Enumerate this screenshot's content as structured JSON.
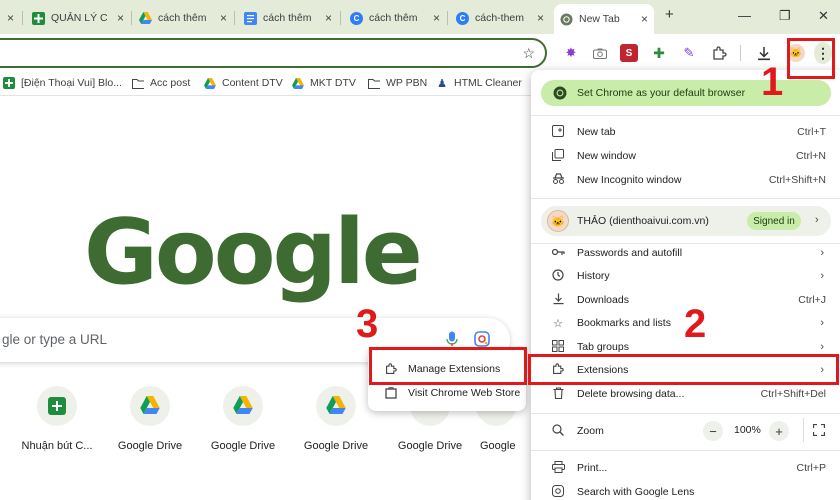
{
  "tabs": [
    {
      "label": "",
      "close": "×"
    },
    {
      "label": "QUẢN LÝ C",
      "close": "×"
    },
    {
      "label": "cách thêm",
      "close": "×"
    },
    {
      "label": "cách thêm",
      "close": "×"
    },
    {
      "label": "cách thêm",
      "close": "×"
    },
    {
      "label": "cách-them",
      "close": "×"
    },
    {
      "label": "New Tab",
      "close": "×"
    }
  ],
  "new_tab_glyph": "+",
  "window_controls": {
    "minimize": "—",
    "restore": "❐",
    "close": "✕"
  },
  "bookmarks": [
    {
      "label": "[Điện Thoại Vui] Blo..."
    },
    {
      "label": "Acc post"
    },
    {
      "label": "Content DTV"
    },
    {
      "label": "MKT DTV"
    },
    {
      "label": "WP PBN"
    },
    {
      "label": "HTML Cleaner"
    }
  ],
  "content": {
    "logo": "Google",
    "search_placeholder": "gle or type a URL",
    "shortcuts": [
      {
        "label": "Nhuận bút C..."
      },
      {
        "label": "Google Drive"
      },
      {
        "label": "Google Drive"
      },
      {
        "label": "Google Drive"
      },
      {
        "label": "Google Drive"
      },
      {
        "label": "Google"
      }
    ]
  },
  "submenu": {
    "items": [
      {
        "label": "Manage Extensions"
      },
      {
        "label": "Visit Chrome Web Store"
      }
    ]
  },
  "menu": {
    "default_banner": "Set Chrome as your default browser",
    "group1": [
      {
        "label": "New tab",
        "shortcut": "Ctrl+T"
      },
      {
        "label": "New window",
        "shortcut": "Ctrl+N"
      },
      {
        "label": "New Incognito window",
        "shortcut": "Ctrl+Shift+N"
      }
    ],
    "profile": {
      "name": "THẢO (dienthoaivui.com.vn)",
      "badge": "Signed in",
      "arrow": "›"
    },
    "group2": [
      {
        "label": "Passwords and autofill",
        "shortcut": "›"
      },
      {
        "label": "History",
        "shortcut": "›"
      },
      {
        "label": "Downloads",
        "shortcut": "Ctrl+J"
      },
      {
        "label": "Bookmarks and lists",
        "shortcut": "›"
      },
      {
        "label": "Tab groups",
        "shortcut": "›"
      },
      {
        "label": "Extensions",
        "shortcut": "›"
      },
      {
        "label": "Delete browsing data...",
        "shortcut": "Ctrl+Shift+Del"
      }
    ],
    "zoom": {
      "label": "Zoom",
      "minus": "−",
      "value": "100%",
      "plus": "+"
    },
    "group3": [
      {
        "label": "Print...",
        "shortcut": "Ctrl+P"
      },
      {
        "label": "Search with Google Lens",
        "shortcut": ""
      }
    ]
  },
  "annotations": {
    "one": "1",
    "two": "2",
    "three": "3"
  },
  "colors": {
    "highlight": "#e01a1a",
    "accent": "#3e6b32",
    "banner": "#c9eca8"
  }
}
